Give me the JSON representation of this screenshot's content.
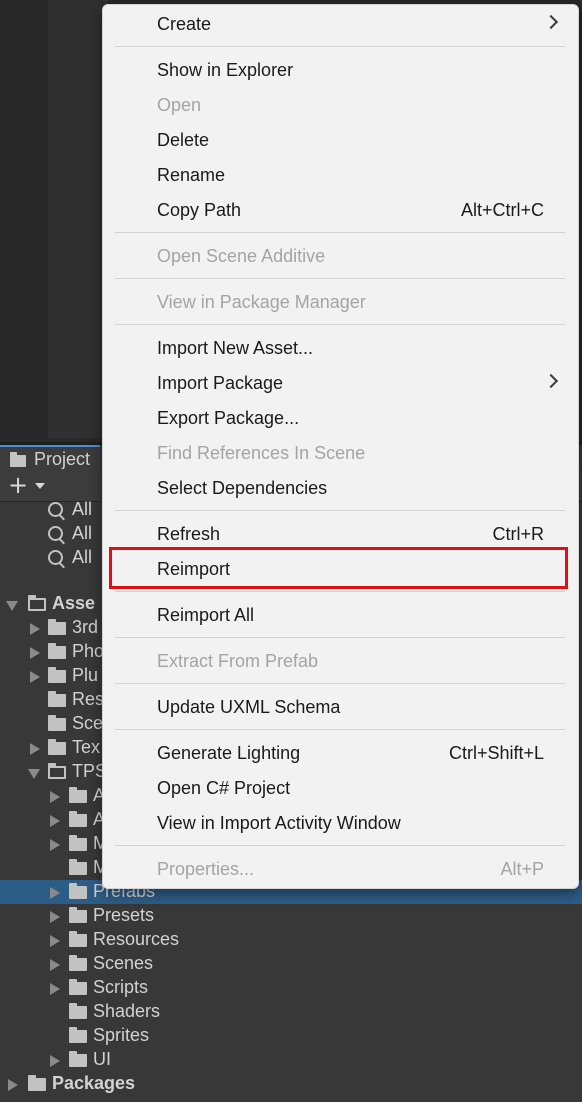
{
  "project_panel": {
    "tab_label": "Project",
    "search_items": [
      "All ",
      "All ",
      "All "
    ],
    "tree": [
      {
        "label": "Asse",
        "bold": true
      },
      {
        "label": "3rd"
      },
      {
        "label": "Pho"
      },
      {
        "label": "Plu"
      },
      {
        "label": "Res"
      },
      {
        "label": "Sce"
      },
      {
        "label": "Tex"
      },
      {
        "label": "TPS"
      },
      {
        "label": "A"
      },
      {
        "label": "A"
      },
      {
        "label": "M"
      },
      {
        "label": "M"
      },
      {
        "label": "Prefabs"
      },
      {
        "label": "Presets"
      },
      {
        "label": "Resources"
      },
      {
        "label": "Scenes"
      },
      {
        "label": "Scripts"
      },
      {
        "label": "Shaders"
      },
      {
        "label": "Sprites"
      },
      {
        "label": "UI"
      },
      {
        "label": "Packages",
        "bold": true
      }
    ]
  },
  "context_menu": {
    "items": [
      {
        "label": "Create",
        "shortcut": "",
        "disabled": false,
        "submenu": true
      },
      {
        "label": "Show in Explorer",
        "shortcut": "",
        "disabled": false
      },
      {
        "label": "Open",
        "shortcut": "",
        "disabled": true
      },
      {
        "label": "Delete",
        "shortcut": "",
        "disabled": false
      },
      {
        "label": "Rename",
        "shortcut": "",
        "disabled": false
      },
      {
        "label": "Copy Path",
        "shortcut": "Alt+Ctrl+C",
        "disabled": false
      },
      {
        "label": "Open Scene Additive",
        "shortcut": "",
        "disabled": true
      },
      {
        "label": "View in Package Manager",
        "shortcut": "",
        "disabled": true
      },
      {
        "label": "Import New Asset...",
        "shortcut": "",
        "disabled": false
      },
      {
        "label": "Import Package",
        "shortcut": "",
        "disabled": false,
        "submenu": true
      },
      {
        "label": "Export Package...",
        "shortcut": "",
        "disabled": false
      },
      {
        "label": "Find References In Scene",
        "shortcut": "",
        "disabled": true
      },
      {
        "label": "Select Dependencies",
        "shortcut": "",
        "disabled": false
      },
      {
        "label": "Refresh",
        "shortcut": "Ctrl+R",
        "disabled": false
      },
      {
        "label": "Reimport",
        "shortcut": "",
        "disabled": false,
        "highlighted": true
      },
      {
        "label": "Reimport All",
        "shortcut": "",
        "disabled": false
      },
      {
        "label": "Extract From Prefab",
        "shortcut": "",
        "disabled": true
      },
      {
        "label": "Update UXML Schema",
        "shortcut": "",
        "disabled": false
      },
      {
        "label": "Generate Lighting",
        "shortcut": "Ctrl+Shift+L",
        "disabled": false
      },
      {
        "label": "Open C# Project",
        "shortcut": "",
        "disabled": false
      },
      {
        "label": "View in Import Activity Window",
        "shortcut": "",
        "disabled": false
      },
      {
        "label": "Properties...",
        "shortcut": "Alt+P",
        "disabled": true
      }
    ]
  },
  "colors": {
    "highlight_border": "#e01010",
    "selected_row": "#2c5d87",
    "menu_background": "#f2f2f2"
  }
}
